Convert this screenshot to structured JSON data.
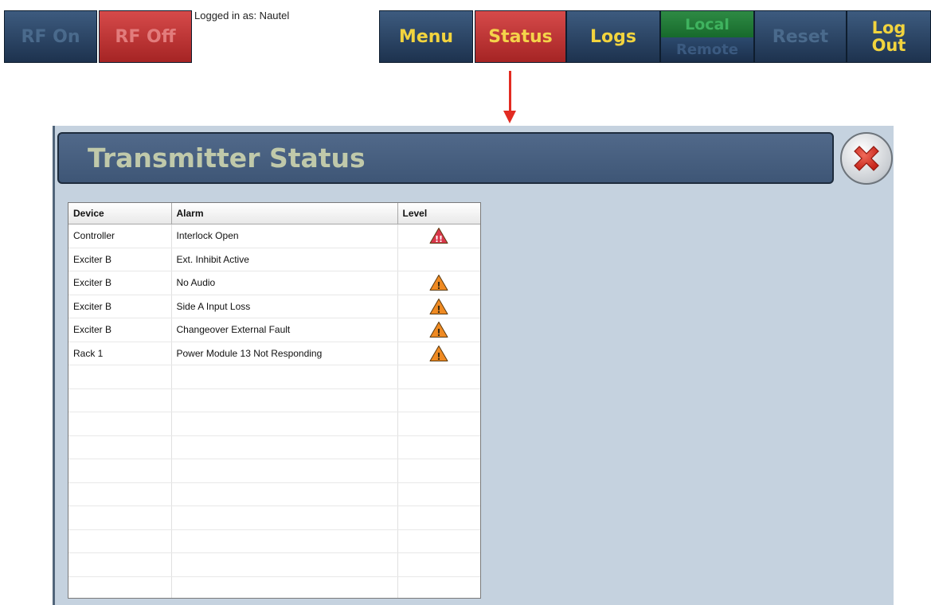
{
  "toolbar": {
    "rf_on": "RF On",
    "rf_off": "RF Off",
    "login_text": "Logged in as: Nautel",
    "menu": "Menu",
    "status": "Status",
    "logs": "Logs",
    "local": "Local",
    "remote": "Remote",
    "reset": "Reset",
    "logout_line1": "Log",
    "logout_line2": "Out"
  },
  "panel": {
    "title": "Transmitter Status"
  },
  "table": {
    "headers": {
      "device": "Device",
      "alarm": "Alarm",
      "level": "Level"
    },
    "rows": [
      {
        "device": "Controller",
        "alarm": "Interlock Open",
        "level": "critical"
      },
      {
        "device": "Exciter B",
        "alarm": "Ext. Inhibit Active",
        "level": ""
      },
      {
        "device": "Exciter B",
        "alarm": "No Audio",
        "level": "warning"
      },
      {
        "device": "Exciter B",
        "alarm": "Side A Input Loss",
        "level": "warning"
      },
      {
        "device": "Exciter B",
        "alarm": "Changeover External Fault",
        "level": "warning"
      },
      {
        "device": "Rack 1",
        "alarm": "Power Module 13 Not Responding",
        "level": "warning"
      }
    ]
  },
  "colors": {
    "critical": "#d9374b",
    "warning": "#ef8a22",
    "title_text": "#c0c9aa",
    "button_text": "#f2d43e"
  },
  "icons": {
    "critical": "critical-alarm-icon",
    "warning": "warning-alarm-icon",
    "close": "close-icon"
  }
}
